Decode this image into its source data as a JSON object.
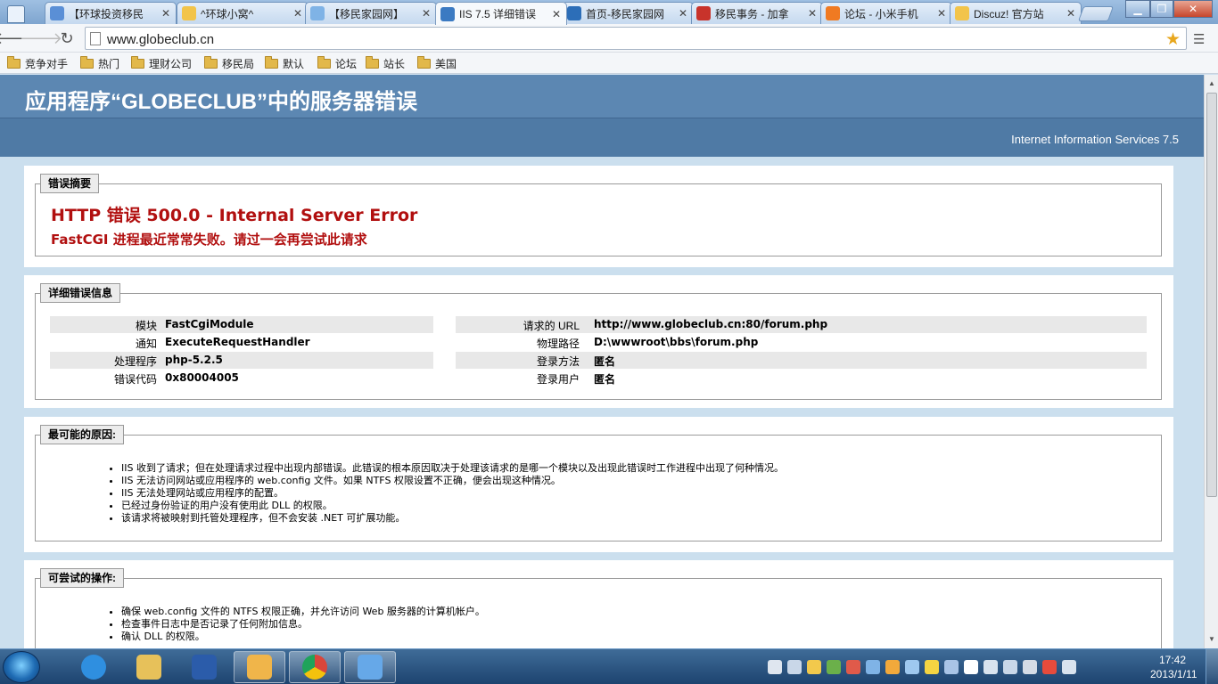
{
  "browser": {
    "tabs": [
      {
        "title": "【环球投资移民",
        "favicon_color": "#5a8fd6"
      },
      {
        "title": "^环球小窝^",
        "favicon_color": "#f2c44a"
      },
      {
        "title": "【移民家园网】",
        "favicon_color": "#7fb3e6"
      },
      {
        "title": "IIS 7.5 详细错误",
        "favicon_color": "#3b7ac2"
      },
      {
        "title": "首页-移民家园网",
        "favicon_color": "#2c6eb8"
      },
      {
        "title": "移民事务 - 加拿",
        "favicon_color": "#c8332b"
      },
      {
        "title": "论坛 - 小米手机",
        "favicon_color": "#f07a22"
      },
      {
        "title": "Discuz! 官方站",
        "favicon_color": "#f2c44a"
      }
    ],
    "active_tab_index": 3,
    "url": "www.globeclub.cn",
    "bookmarks": [
      "竞争对手",
      "热门",
      "理财公司",
      "移民局",
      "默认",
      "论坛",
      "站长",
      "美国"
    ]
  },
  "page": {
    "title": "应用程序“GLOBECLUB”中的服务器错误",
    "server": "Internet Information Services 7.5",
    "summary": {
      "legend": "错误摘要",
      "heading": "HTTP 错误 500.0 - Internal Server Error",
      "message": "FastCGI 进程最近常常失败。请过一会再尝试此请求"
    },
    "details": {
      "legend": "详细错误信息",
      "left": [
        {
          "label": "模块",
          "value": "FastCgiModule"
        },
        {
          "label": "通知",
          "value": "ExecuteRequestHandler"
        },
        {
          "label": "处理程序",
          "value": "php-5.2.5"
        },
        {
          "label": "错误代码",
          "value": "0x80004005"
        }
      ],
      "right": [
        {
          "label": "请求的 URL",
          "value": "http://www.globeclub.cn:80/forum.php"
        },
        {
          "label": "物理路径",
          "value": "D:\\wwwroot\\bbs\\forum.php"
        },
        {
          "label": "登录方法",
          "value": "匿名"
        },
        {
          "label": "登录用户",
          "value": "匿名"
        }
      ]
    },
    "causes": {
      "legend": "最可能的原因:",
      "items": [
        "IIS 收到了请求；但在处理请求过程中出现内部错误。此错误的根本原因取决于处理该请求的是哪一个模块以及出现此错误时工作进程中出现了何种情况。",
        "IIS 无法访问网站或应用程序的 web.config 文件。如果 NTFS 权限设置不正确，便会出现这种情况。",
        "IIS 无法处理网站或应用程序的配置。",
        "已经过身份验证的用户没有使用此 DLL 的权限。",
        "该请求将被映射到托管处理程序，但不会安装 .NET 可扩展功能。"
      ]
    },
    "actions": {
      "legend": "可尝试的操作:",
      "items": [
        "确保 web.config 文件的 NTFS 权限正确，并允许访问 Web 服务器的计算机帐户。",
        "检查事件日志中是否记录了任何附加信息。",
        "确认 DLL 的权限。"
      ]
    }
  },
  "taskbar": {
    "apps": [
      {
        "name": "internet-explorer",
        "color": "#2f8fe0",
        "open": false
      },
      {
        "name": "file-explorer",
        "color": "#e7c15a",
        "open": false
      },
      {
        "name": "word",
        "color": "#2b5caa",
        "open": false
      },
      {
        "name": "outlook",
        "color": "#f0b54a",
        "open": true
      },
      {
        "name": "chrome",
        "color": "#d9463a",
        "open": true
      },
      {
        "name": "qq-messenger",
        "color": "#66a8e8",
        "open": true
      }
    ],
    "time": "17:42",
    "date": "2013/1/11"
  }
}
